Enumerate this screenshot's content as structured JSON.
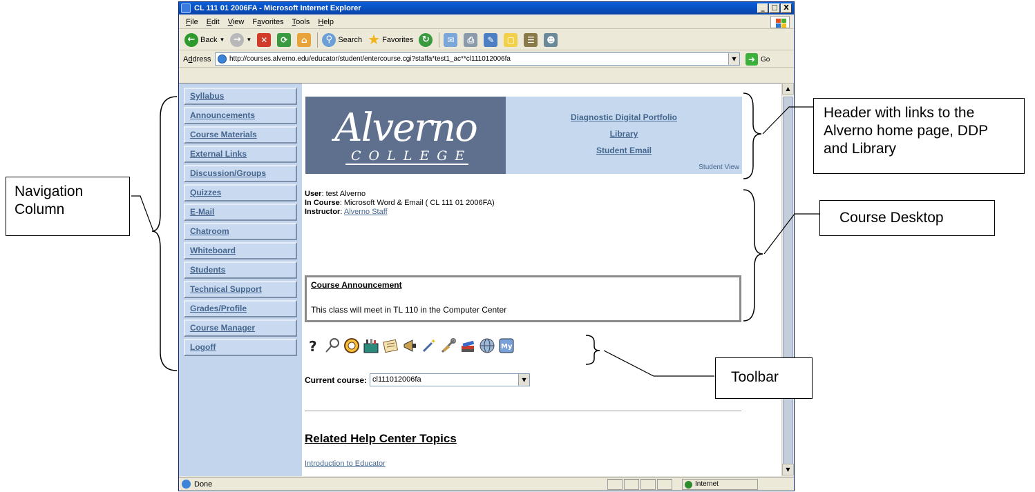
{
  "window": {
    "title": "CL 111 01 2006FA - Microsoft Internet Explorer",
    "controls": [
      "_",
      "□",
      "X"
    ]
  },
  "menubar": {
    "items": [
      {
        "pre": "",
        "key": "F",
        "post": "ile"
      },
      {
        "pre": "",
        "key": "E",
        "post": "dit"
      },
      {
        "pre": "",
        "key": "V",
        "post": "iew"
      },
      {
        "pre": "F",
        "key": "a",
        "post": "vorites"
      },
      {
        "pre": "",
        "key": "T",
        "post": "ools"
      },
      {
        "pre": "",
        "key": "H",
        "post": "elp"
      }
    ]
  },
  "toolbar": {
    "back": "Back",
    "search": "Search",
    "favorites": "Favorites"
  },
  "address": {
    "label_pre": "A",
    "label_key": "d",
    "label_post": "dress",
    "url": "http://courses.alverno.edu/educator/student/entercourse.cgi?staffa*test1_ac**cl111012006fa",
    "go": "Go"
  },
  "nav": {
    "items": [
      "Syllabus",
      "Announcements",
      "Course Materials",
      "External Links",
      "Discussion/Groups",
      "Quizzes",
      "E-Mail",
      "Chatroom",
      "Whiteboard",
      "Students",
      "Technical Support",
      "Grades/Profile",
      "Course Manager",
      "Logoff"
    ]
  },
  "banner": {
    "logo_word": "Alverno",
    "logo_sub": "COLLEGE",
    "links": [
      "Diagnostic Digital Portfolio",
      "Library",
      "Student Email"
    ],
    "view_label": "Student View"
  },
  "userinfo": {
    "user_label": "User",
    "user_value": "test Alverno",
    "course_label": "In Course",
    "course_value": "Microsoft Word & Email ( CL 111 01 2006FA)",
    "instructor_label": "Instructor",
    "instructor_value": "Alverno Staff"
  },
  "announcement": {
    "title": "Course Announcement",
    "text": "This class will meet in TL 110 in the Computer Center"
  },
  "course_tools": {
    "icons": [
      "help-icon",
      "search-icon",
      "calendar-icon",
      "toolbox-icon",
      "notes-icon",
      "megaphone-icon",
      "magic-wand-icon",
      "tools-icon",
      "books-icon",
      "globe-icon",
      "my-page-icon"
    ]
  },
  "current_course": {
    "label": "Current course",
    "value": "cl111012006fa"
  },
  "related": {
    "title": "Related Help Center Topics",
    "link": "Introduction to Educator"
  },
  "status": {
    "text": "Done",
    "zone": "Internet"
  },
  "annotations": {
    "navigation": "Navigation Column",
    "header": "Header with links to the Alverno home page, DDP and Library",
    "desktop": "Course Desktop",
    "toolbar": "Toolbar"
  },
  "colors": {
    "nav_background": "#c3d5ec",
    "link": "#45668e",
    "logo_background": "#5e708d",
    "title_bar": "#0a5fd8"
  }
}
